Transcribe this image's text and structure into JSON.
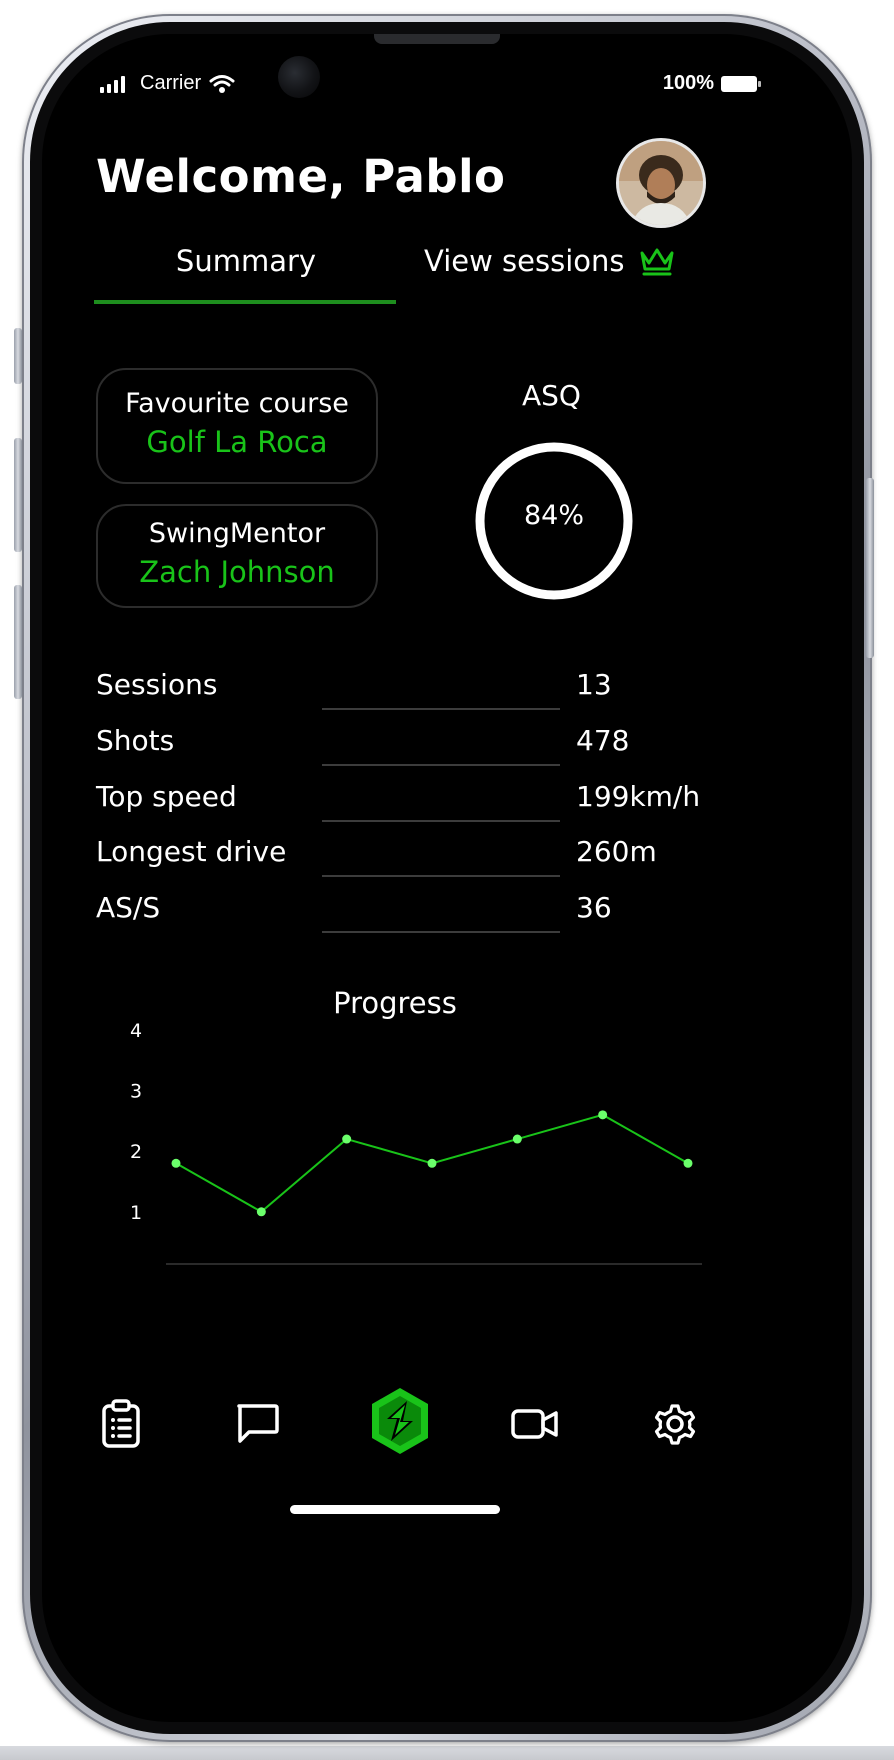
{
  "status": {
    "carrier": "Carrier",
    "battery": "100%"
  },
  "header": {
    "welcome": "Welcome, Pablo"
  },
  "tabs": {
    "summary": "Summary",
    "sessions": "View sessions"
  },
  "cards": {
    "favourite": {
      "title": "Favourite course",
      "value": "Golf La Roca"
    },
    "mentor": {
      "title": "SwingMentor",
      "value": "Zach Johnson"
    }
  },
  "asq": {
    "title": "ASQ",
    "value": "84%",
    "fraction": 0.84
  },
  "stats": [
    {
      "label": "Sessions",
      "value": "13"
    },
    {
      "label": "Shots",
      "value": "478"
    },
    {
      "label": "Top speed",
      "value": "199km/h"
    },
    {
      "label": "Longest drive",
      "value": "260m"
    },
    {
      "label": "AS/S",
      "value": "36"
    }
  ],
  "chart_data": {
    "type": "line",
    "title": "Progress",
    "x": [
      1,
      2,
      3,
      4,
      5,
      6,
      7
    ],
    "series": [
      {
        "values": [
          1.8,
          1.0,
          2.2,
          1.8,
          2.2,
          2.6,
          1.8
        ]
      }
    ],
    "yticks": [
      1,
      2,
      3,
      4
    ],
    "ylim": [
      0.6,
      4
    ],
    "grid": false,
    "color": "#19c319"
  },
  "nav": {
    "items": [
      "clipboard-icon",
      "chat-icon",
      "logo-icon",
      "video-icon",
      "gear-icon"
    ]
  },
  "colors": {
    "accent": "#19c319",
    "background": "#000000"
  }
}
